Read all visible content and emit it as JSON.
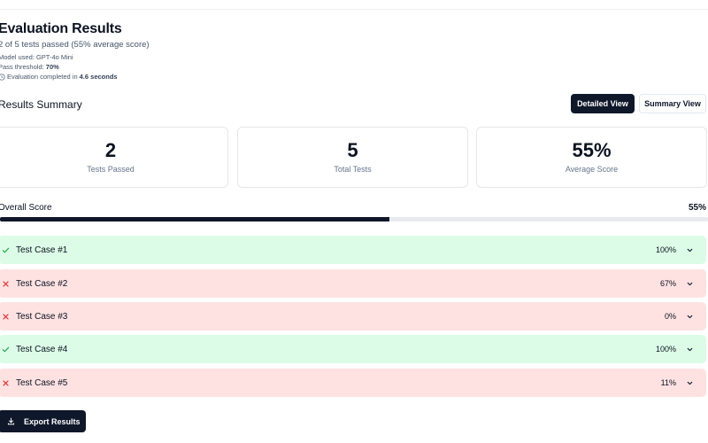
{
  "header": {
    "title": "Evaluation Results",
    "subtitle": "2 of 5 tests passed (55% average score)",
    "model_prefix": "Model used: ",
    "model_value": "GPT-4o Mini",
    "threshold_prefix": "Pass threshold: ",
    "threshold_value": "70%",
    "completed_prefix": "Evaluation completed in ",
    "completed_value": "4.6 seconds"
  },
  "summary": {
    "title": "Results Summary",
    "detailed_view_label": "Detailed View",
    "summary_view_label": "Summary View",
    "active_view": "Detailed View",
    "cards": [
      {
        "value": "2",
        "label": "Tests Passed"
      },
      {
        "value": "5",
        "label": "Total Tests"
      },
      {
        "value": "55%",
        "label": "Average Score"
      }
    ]
  },
  "overall": {
    "label": "Overall Score",
    "value_text": "55%",
    "progress_fraction": 0.55
  },
  "test_cases": [
    {
      "name": "Test Case #1",
      "score": "100%",
      "status": "pass",
      "status_icon": "check-icon"
    },
    {
      "name": "Test Case #2",
      "score": "67%",
      "status": "fail",
      "status_icon": "x-icon"
    },
    {
      "name": "Test Case #3",
      "score": "0%",
      "status": "fail",
      "status_icon": "x-icon"
    },
    {
      "name": "Test Case #4",
      "score": "100%",
      "status": "pass",
      "status_icon": "check-icon"
    },
    {
      "name": "Test Case #5",
      "score": "11%",
      "status": "fail",
      "status_icon": "x-icon"
    }
  ],
  "actions": {
    "export_label": "Export Results",
    "export_icon": "download-icon"
  },
  "colors": {
    "primary": "#0f172a",
    "pass_bg": "#dcfce7",
    "fail_bg": "#fee2e2",
    "pass_icon": "#16a34a",
    "fail_icon": "#dc2626"
  }
}
